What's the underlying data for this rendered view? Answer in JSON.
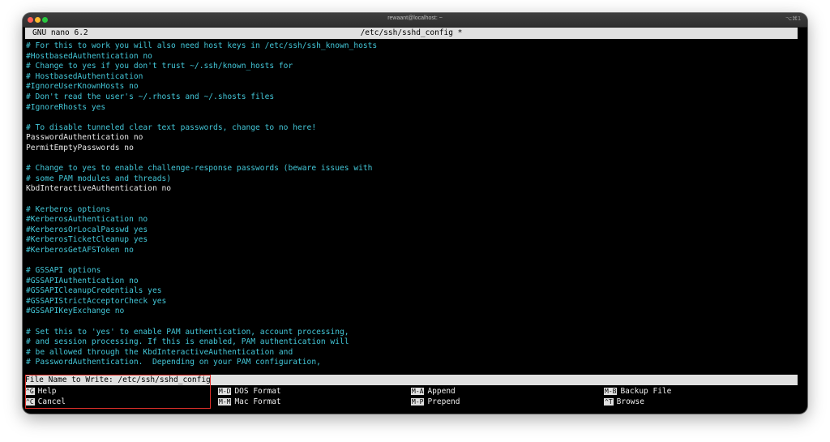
{
  "window": {
    "title": "rewaant@localhost: ~",
    "shortcut": "⌥⌘1"
  },
  "nano": {
    "version": "GNU nano 6.2",
    "filename": "/etc/ssh/sshd_config *"
  },
  "lines": [
    {
      "type": "comment",
      "text": "# For this to work you will also need host keys in /etc/ssh/ssh_known_hosts"
    },
    {
      "type": "comment",
      "text": "#HostbasedAuthentication no"
    },
    {
      "type": "comment",
      "text": "# Change to yes if you don't trust ~/.ssh/known_hosts for"
    },
    {
      "type": "comment",
      "text": "# HostbasedAuthentication"
    },
    {
      "type": "comment",
      "text": "#IgnoreUserKnownHosts no"
    },
    {
      "type": "comment",
      "text": "# Don't read the user's ~/.rhosts and ~/.shosts files"
    },
    {
      "type": "comment",
      "text": "#IgnoreRhosts yes"
    },
    {
      "type": "blank",
      "text": ""
    },
    {
      "type": "comment",
      "text": "# To disable tunneled clear text passwords, change to no here!"
    },
    {
      "type": "plain",
      "text": "PasswordAuthentication no"
    },
    {
      "type": "plain",
      "text": "PermitEmptyPasswords no"
    },
    {
      "type": "blank",
      "text": ""
    },
    {
      "type": "comment",
      "text": "# Change to yes to enable challenge-response passwords (beware issues with"
    },
    {
      "type": "comment",
      "text": "# some PAM modules and threads)"
    },
    {
      "type": "plain",
      "text": "KbdInteractiveAuthentication no"
    },
    {
      "type": "blank",
      "text": ""
    },
    {
      "type": "comment",
      "text": "# Kerberos options"
    },
    {
      "type": "comment",
      "text": "#KerberosAuthentication no"
    },
    {
      "type": "comment",
      "text": "#KerberosOrLocalPasswd yes"
    },
    {
      "type": "comment",
      "text": "#KerberosTicketCleanup yes"
    },
    {
      "type": "comment",
      "text": "#KerberosGetAFSToken no"
    },
    {
      "type": "blank",
      "text": ""
    },
    {
      "type": "comment",
      "text": "# GSSAPI options"
    },
    {
      "type": "comment",
      "text": "#GSSAPIAuthentication no"
    },
    {
      "type": "comment",
      "text": "#GSSAPICleanupCredentials yes"
    },
    {
      "type": "comment",
      "text": "#GSSAPIStrictAcceptorCheck yes"
    },
    {
      "type": "comment",
      "text": "#GSSAPIKeyExchange no"
    },
    {
      "type": "blank",
      "text": ""
    },
    {
      "type": "comment",
      "text": "# Set this to 'yes' to enable PAM authentication, account processing,"
    },
    {
      "type": "comment",
      "text": "# and session processing. If this is enabled, PAM authentication will"
    },
    {
      "type": "comment",
      "text": "# be allowed through the KbdInteractiveAuthentication and"
    },
    {
      "type": "comment",
      "text": "# PasswordAuthentication.  Depending on your PAM configuration,"
    }
  ],
  "prompt": {
    "label": "File Name to Write: ",
    "value": "/etc/ssh/sshd_config"
  },
  "shortcuts": [
    {
      "key": "^G",
      "label": "Help"
    },
    {
      "key": "^C",
      "label": "Cancel"
    },
    {
      "key": "M-D",
      "label": "DOS Format"
    },
    {
      "key": "M-M",
      "label": "Mac Format"
    },
    {
      "key": "M-A",
      "label": "Append"
    },
    {
      "key": "M-P",
      "label": "Prepend"
    },
    {
      "key": "M-B",
      "label": "Backup File"
    },
    {
      "key": "^T",
      "label": "Browse"
    }
  ],
  "colors": {
    "comment": "#43c7d8",
    "plain": "#e8e8e8",
    "highlight": "#e0302a",
    "statusbar": "#e0e0e0"
  }
}
